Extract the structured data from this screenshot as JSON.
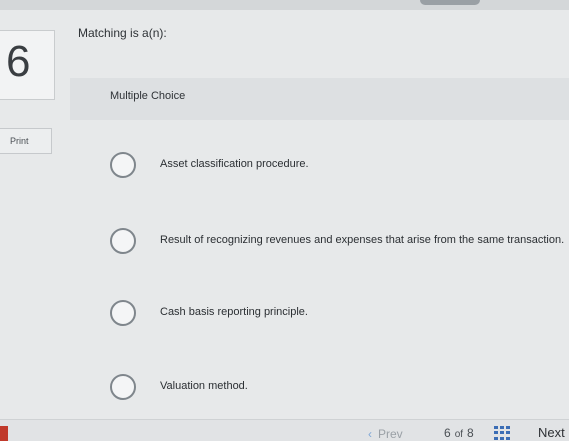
{
  "question": {
    "number": "6",
    "text": "Matching is a(n):",
    "type_label": "Multiple Choice"
  },
  "print_label": "Print",
  "options": [
    "Asset classification procedure.",
    "Result of recognizing revenues and expenses that arise from the same transaction.",
    "Cash basis reporting principle.",
    "Valuation method."
  ],
  "footer": {
    "prev_label": "Prev",
    "current_page": "6",
    "of_label": "of",
    "total_pages": "8",
    "next_label": "Next"
  },
  "colors": {
    "page_background": "#e7e9ea",
    "accent_blue": "#3b6db5",
    "red_marker": "#c0392b"
  },
  "icons": {
    "prev": "chevron-left-icon",
    "overview": "grid-icon",
    "radio": "radio-icon"
  }
}
